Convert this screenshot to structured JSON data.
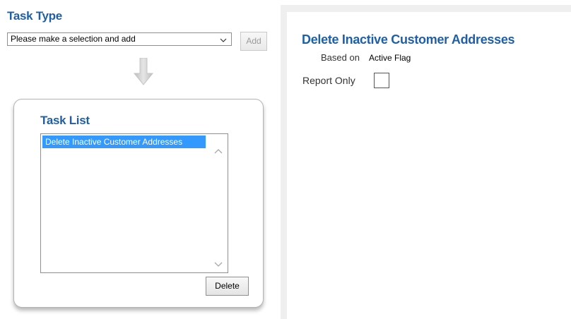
{
  "task_type": {
    "title": "Task Type",
    "select_value": "Please make a selection and add",
    "add_label": "Add"
  },
  "task_list": {
    "title": "Task List",
    "items": [
      {
        "label": "Delete Inactive Customer Addresses",
        "selected": true
      }
    ],
    "delete_label": "Delete"
  },
  "detail": {
    "title": "Delete Inactive Customer Addresses",
    "based_on_label": "Based on",
    "based_on_value": "Active Flag",
    "report_only_label": "Report Only",
    "report_only_checked": false
  },
  "icons": {
    "select": "chevron-down-icon",
    "flow": "arrow-down-icon",
    "scroll_up": "chevron-up-icon",
    "scroll_down": "chevron-down-icon"
  },
  "colors": {
    "heading": "#1f5fa6",
    "selection": "#3399ff"
  }
}
